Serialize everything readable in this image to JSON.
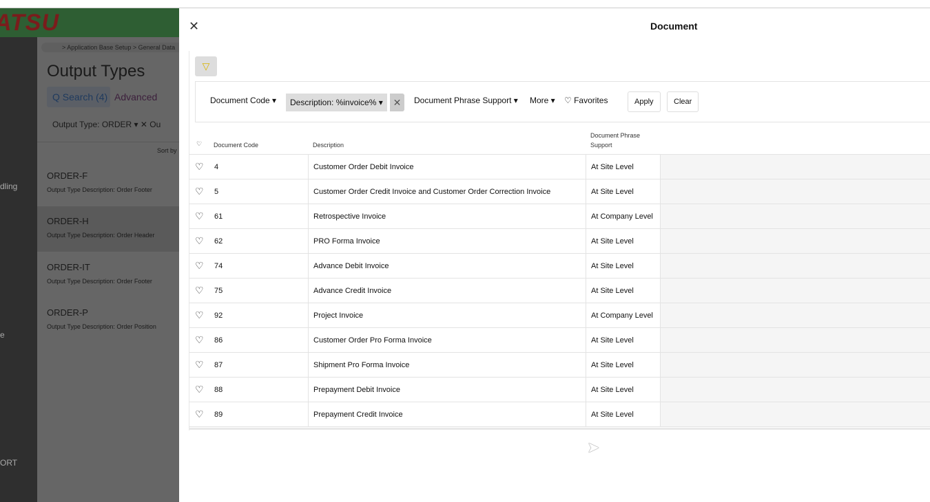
{
  "background": {
    "brand": "ATSU",
    "sidebar_fragments": [
      "dling",
      "e",
      "ORT"
    ],
    "breadcrumb": "> Application Base Setup  >  General Data",
    "page_title": "Output Types",
    "search_label": "Q Search (4)",
    "advanced_label": "Advanced",
    "chip_label": "Output Type: ORDER ▾  ✕     Ou",
    "sort_by": "Sort by",
    "cards": [
      {
        "title": "ORDER-F",
        "desc": "Output Type Description:   Order Footer"
      },
      {
        "title": "ORDER-H",
        "desc": "Output Type Description:   Order Header"
      },
      {
        "title": "ORDER-IT",
        "desc": "Output Type Description:   Order Footer"
      },
      {
        "title": "ORDER-P",
        "desc": "Output Type Description:   Order Position"
      }
    ]
  },
  "modal": {
    "title": "Document",
    "close": "✕",
    "filter_icon": "▽",
    "filters": {
      "code": "Document Code ▾",
      "description": "Description:  %invoice%  ▾",
      "clear_x": "✕",
      "phrase": "Document Phrase Support ▾",
      "more": "More ▾",
      "favorites": "♡  Favorites",
      "apply": "Apply",
      "clear": "Clear"
    },
    "columns": {
      "fav": "♡",
      "code": "Document Code",
      "description": "Description",
      "phrase": "Document Phrase Support"
    },
    "rows": [
      {
        "code": "4",
        "description": "Customer Order Debit Invoice",
        "phrase": "At Site Level"
      },
      {
        "code": "5",
        "description": "Customer Order Credit Invoice and Customer Order Correction Invoice",
        "phrase": "At Site Level"
      },
      {
        "code": "61",
        "description": "Retrospective Invoice",
        "phrase": "At Company Level"
      },
      {
        "code": "62",
        "description": "PRO Forma Invoice",
        "phrase": "At Site Level"
      },
      {
        "code": "74",
        "description": "Advance Debit Invoice",
        "phrase": "At Site Level"
      },
      {
        "code": "75",
        "description": "Advance Credit Invoice",
        "phrase": "At Site Level"
      },
      {
        "code": "92",
        "description": "Project Invoice",
        "phrase": "At Company Level"
      },
      {
        "code": "86",
        "description": "Customer Order Pro Forma Invoice",
        "phrase": "At Site Level"
      },
      {
        "code": "87",
        "description": "Shipment Pro Forma Invoice",
        "phrase": "At Site Level"
      },
      {
        "code": "88",
        "description": "Prepayment Debit Invoice",
        "phrase": "At Site Level"
      },
      {
        "code": "89",
        "description": "Prepayment Credit Invoice",
        "phrase": "At Site Level"
      }
    ]
  }
}
